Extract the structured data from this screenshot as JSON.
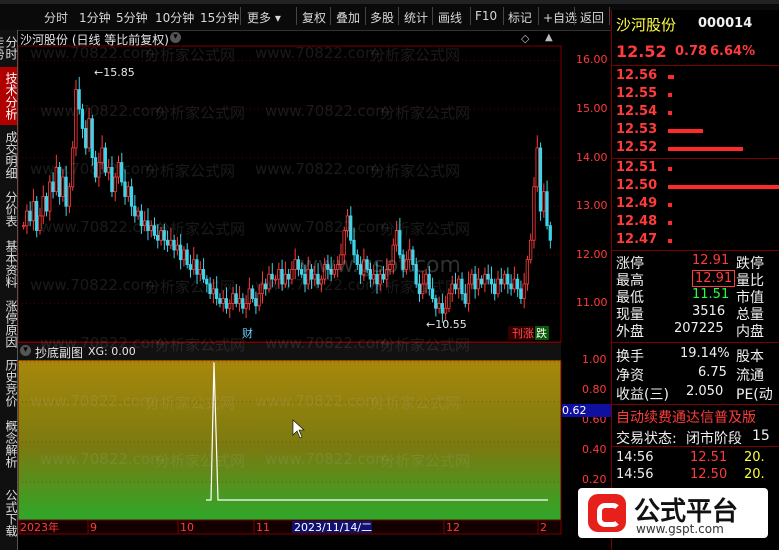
{
  "toolbar": {
    "items": [
      "分时",
      "1分钟",
      "5分钟",
      "10分钟",
      "15分钟",
      "更多",
      "复权",
      "叠加",
      "多股",
      "统计",
      "画线",
      "F10",
      "标记",
      "+自选",
      "返回"
    ]
  },
  "left_tabs": [
    "分时走势",
    "技术分析",
    "成交明细",
    "分价表",
    "基本资料",
    "涨停原因",
    "历史竞价",
    "概念解析",
    "公式下载"
  ],
  "chart": {
    "title": "沙河股份 (日线 等比前复权)",
    "high_label": "15.85",
    "low_label": "10.55",
    "cai_badge": "财",
    "zhang_badge": "涨",
    "die_badge": "跌",
    "y_ticks": [
      "16.00",
      "15.00",
      "14.00",
      "13.00",
      "12.00",
      "11.00"
    ]
  },
  "sub_chart": {
    "title": "抄底副图",
    "value_label": "XG: 0.00",
    "y_ticks": [
      "1.00",
      "0.80",
      "0.60",
      "0.40",
      "0.20"
    ],
    "current_value": "0.62"
  },
  "x_axis": {
    "labels": [
      "2023年",
      "9",
      "10",
      "11",
      "12",
      "2"
    ],
    "cursor_date": "2023/11/14/二"
  },
  "quote": {
    "name": "沙河股份",
    "code": "000014",
    "price": "12.52",
    "change": "0.78",
    "change_pct": "6.64%",
    "asks": [
      {
        "price": "12.56",
        "vol": 0.06
      },
      {
        "price": "12.55",
        "vol": 0.03
      },
      {
        "price": "12.54",
        "vol": 0.03
      },
      {
        "price": "12.53",
        "vol": 0.35
      },
      {
        "price": "12.52",
        "vol": 0.75
      }
    ],
    "bids": [
      {
        "price": "12.51",
        "vol": 0.03
      },
      {
        "price": "12.50",
        "vol": 1.0
      },
      {
        "price": "12.49",
        "vol": 0.03
      },
      {
        "price": "12.48",
        "vol": 0.03
      },
      {
        "price": "12.47",
        "vol": 0.03
      }
    ],
    "stats": [
      {
        "l1": "涨停",
        "v1": "12.91",
        "l2": "跌停"
      },
      {
        "l1": "最高",
        "v1": "12.91",
        "l2": "量比"
      },
      {
        "l1": "最低",
        "v1": "11.51",
        "l2": "市值"
      },
      {
        "l1": "现量",
        "v1": "3516",
        "l2": "总量"
      },
      {
        "l1": "外盘",
        "v1": "207225",
        "l2": "内盘"
      }
    ],
    "stats2": [
      {
        "l1": "换手",
        "v1": "19.14%",
        "l2": "股本"
      },
      {
        "l1": "净资",
        "v1": "6.75",
        "l2": "流通"
      },
      {
        "l1": "收益(三)",
        "v1": "2.050",
        "l2": "PE(动"
      }
    ],
    "concept": "自动续费通达信普及版",
    "status_label": "交易状态:",
    "status_value": "闭市阶段",
    "status_num": "15",
    "ticks": [
      {
        "time": "14:56",
        "price": "12.51",
        "vol": "20."
      },
      {
        "time": "14:56",
        "price": "12.50",
        "vol": "20."
      }
    ]
  },
  "watermark": {
    "site": "www.70822.com",
    "text": "分析家公式网",
    "gspt": "www.gspt.com"
  },
  "logo": {
    "name": "公式平台",
    "url": "www.gspt.com"
  }
}
